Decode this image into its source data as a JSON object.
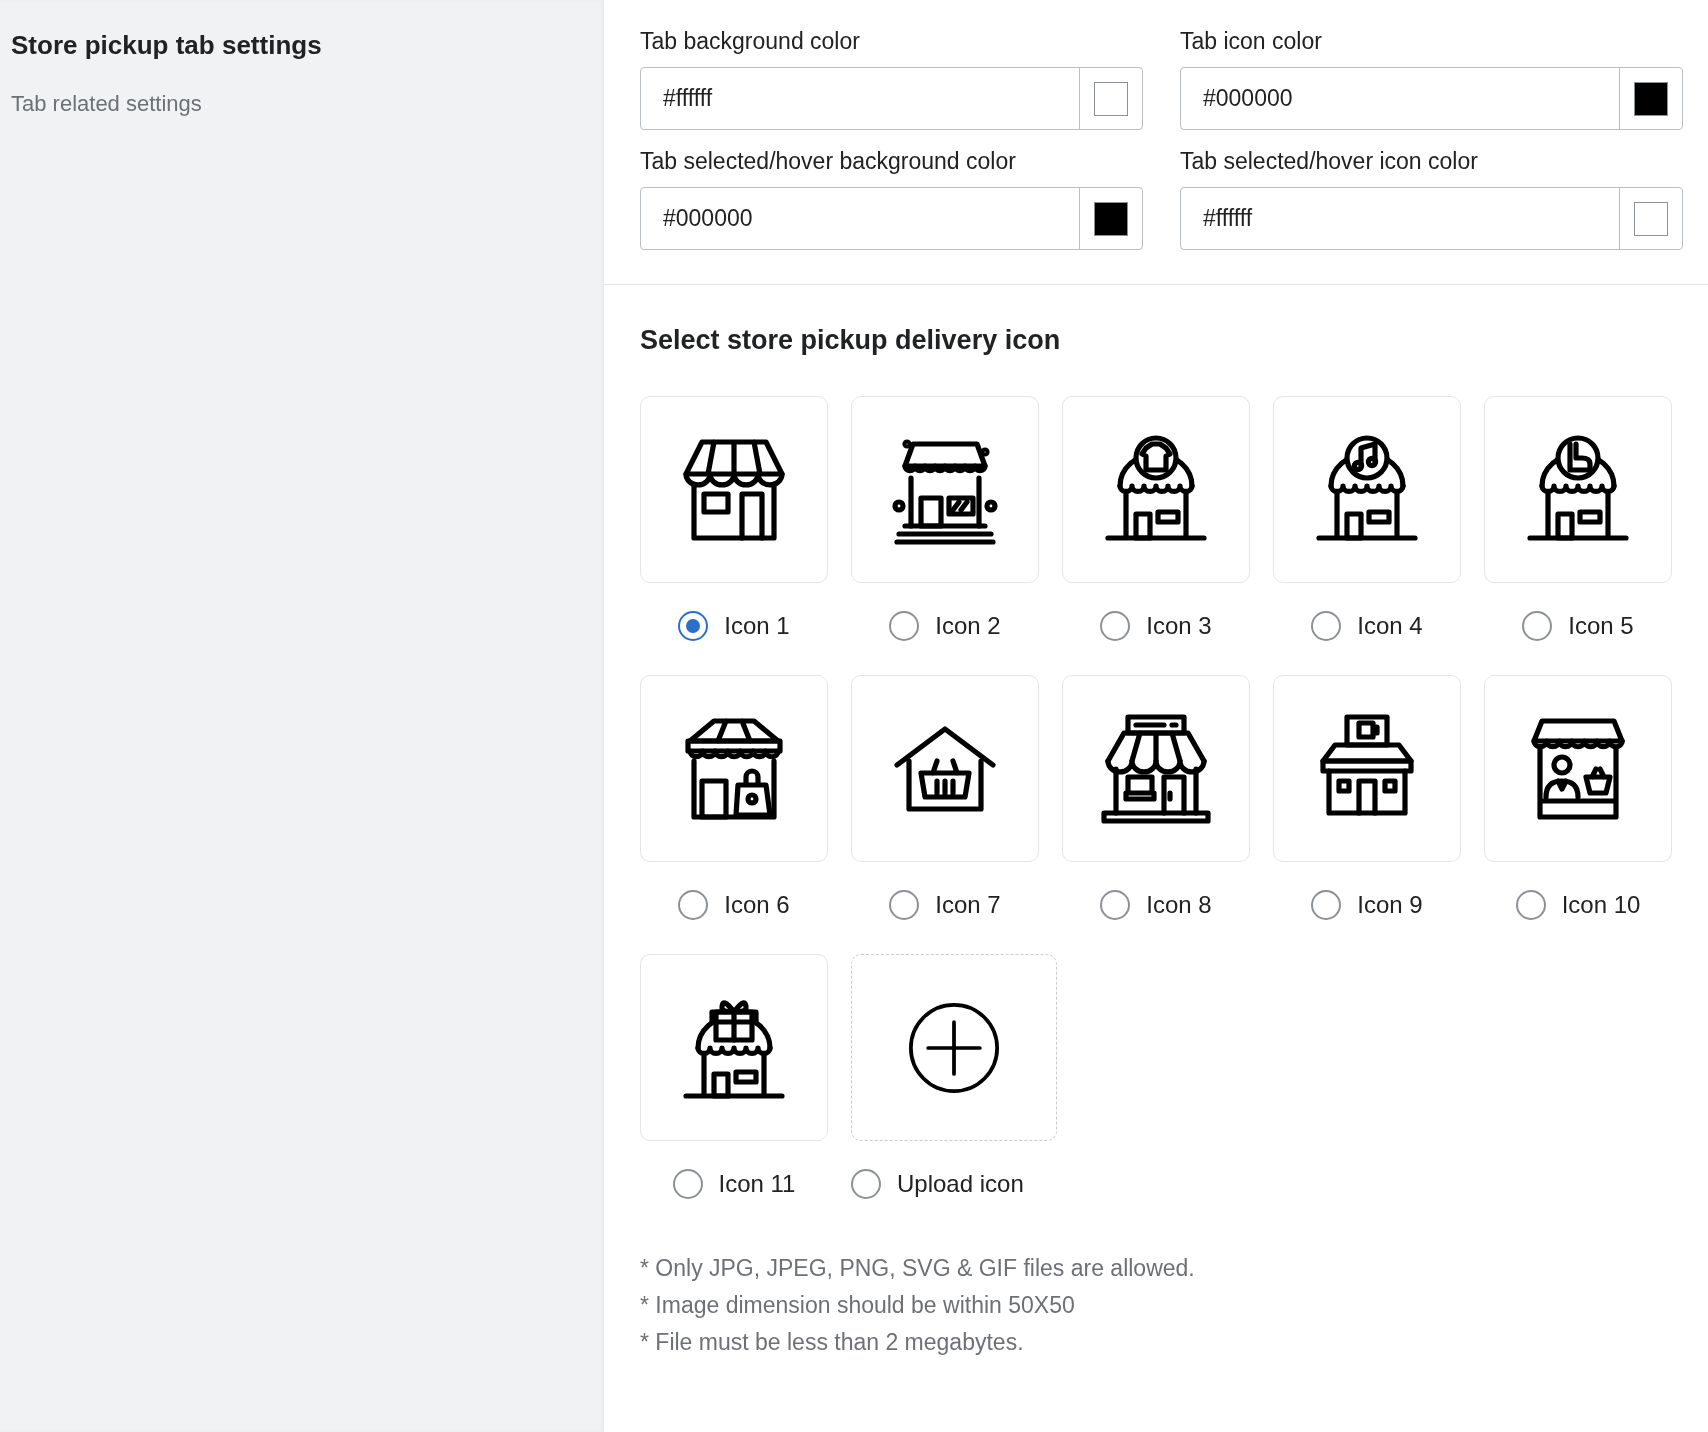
{
  "sidebar": {
    "title": "Store pickup tab settings",
    "subtitle": "Tab related settings"
  },
  "color_fields": [
    {
      "label": "Tab background color",
      "value": "#ffffff",
      "color": "#ffffff"
    },
    {
      "label": "Tab icon color",
      "value": "#000000",
      "color": "#000000"
    },
    {
      "label": "Tab selected/hover background color",
      "value": "#000000",
      "color": "#000000"
    },
    {
      "label": "Tab selected/hover icon color",
      "value": "#ffffff",
      "color": "#ffffff"
    }
  ],
  "icon_section": {
    "heading": "Select store pickup delivery icon",
    "options": [
      {
        "label": "Icon 1",
        "kind": "icon",
        "selected": true
      },
      {
        "label": "Icon 2",
        "kind": "icon",
        "selected": false
      },
      {
        "label": "Icon 3",
        "kind": "icon",
        "selected": false
      },
      {
        "label": "Icon 4",
        "kind": "icon",
        "selected": false
      },
      {
        "label": "Icon 5",
        "kind": "icon",
        "selected": false
      },
      {
        "label": "Icon 6",
        "kind": "icon",
        "selected": false
      },
      {
        "label": "Icon 7",
        "kind": "icon",
        "selected": false
      },
      {
        "label": "Icon 8",
        "kind": "icon",
        "selected": false
      },
      {
        "label": "Icon 9",
        "kind": "icon",
        "selected": false
      },
      {
        "label": "Icon 10",
        "kind": "icon",
        "selected": false
      },
      {
        "label": "Icon 11",
        "kind": "icon",
        "selected": false
      },
      {
        "label": "Upload icon",
        "kind": "upload",
        "selected": false
      }
    ]
  },
  "notes": [
    "* Only JPG, JPEG, PNG, SVG & GIF files are allowed.",
    "* Image dimension should be within 50X50",
    "* File must be less than 2 megabytes."
  ]
}
